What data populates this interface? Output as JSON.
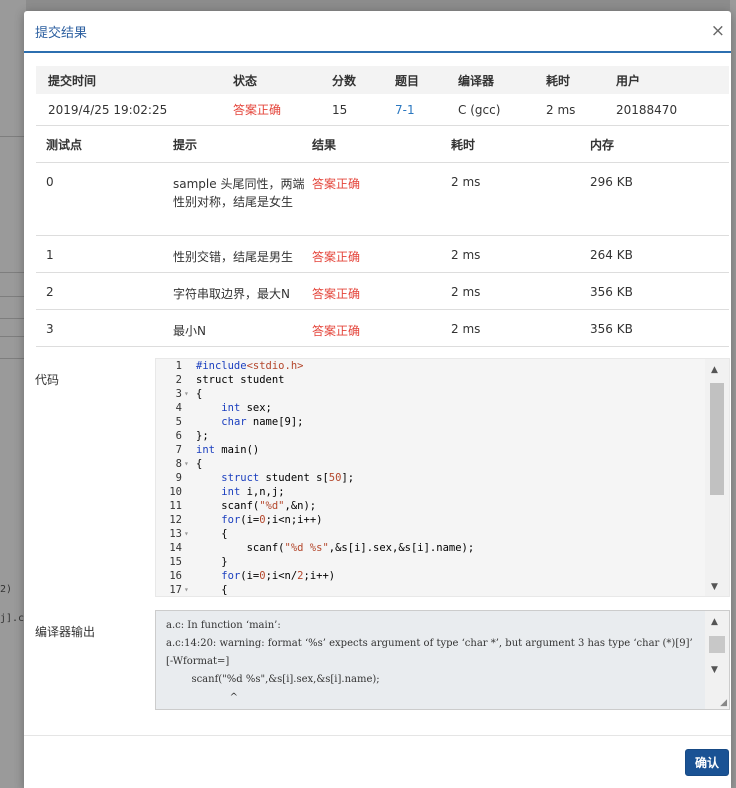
{
  "background": {
    "fragment_a": "2)",
    "fragment_b": "j].c"
  },
  "modal": {
    "title": "提交结果",
    "close_icon": "close-icon"
  },
  "summary": {
    "headers": [
      "提交时间",
      "状态",
      "分数",
      "题目",
      "编译器",
      "耗时",
      "用户"
    ],
    "row": {
      "time": "2019/4/25 19:02:25",
      "status": "答案正确",
      "score": "15",
      "problem": "7-1",
      "compiler": "C (gcc)",
      "duration": "2 ms",
      "user": "20188470"
    }
  },
  "cases": {
    "headers": [
      "测试点",
      "提示",
      "结果",
      "耗时",
      "内存"
    ],
    "rows": [
      {
        "id": "0",
        "hint": "sample 头尾同性，两端性别对称，结尾是女生",
        "result": "答案正确",
        "time": "2 ms",
        "memory": "296 KB"
      },
      {
        "id": "1",
        "hint": "性别交错，结尾是男生",
        "result": "答案正确",
        "time": "2 ms",
        "memory": "264 KB"
      },
      {
        "id": "2",
        "hint": "字符串取边界，最大N",
        "result": "答案正确",
        "time": "2 ms",
        "memory": "356 KB"
      },
      {
        "id": "3",
        "hint": "最小N",
        "result": "答案正确",
        "time": "2 ms",
        "memory": "356 KB"
      }
    ]
  },
  "code": {
    "label": "代码"
  },
  "compiler_output": {
    "label": "编译器输出",
    "text": "a.c: In function ‘main’:\na.c:14:20: warning: format ‘%s’ expects argument of type ‘char *’, but argument 3 has type ‘char (*)[9]’ [-Wformat=]\n        scanf(\"%d %s\",&s[i].sex,&s[i].name);\n                    ^"
  },
  "footer": {
    "confirm_label": "确认"
  },
  "colors": {
    "accent": "#2c6fb0",
    "status_ok": "#e4443a",
    "confirm_button": "#1a5294"
  }
}
